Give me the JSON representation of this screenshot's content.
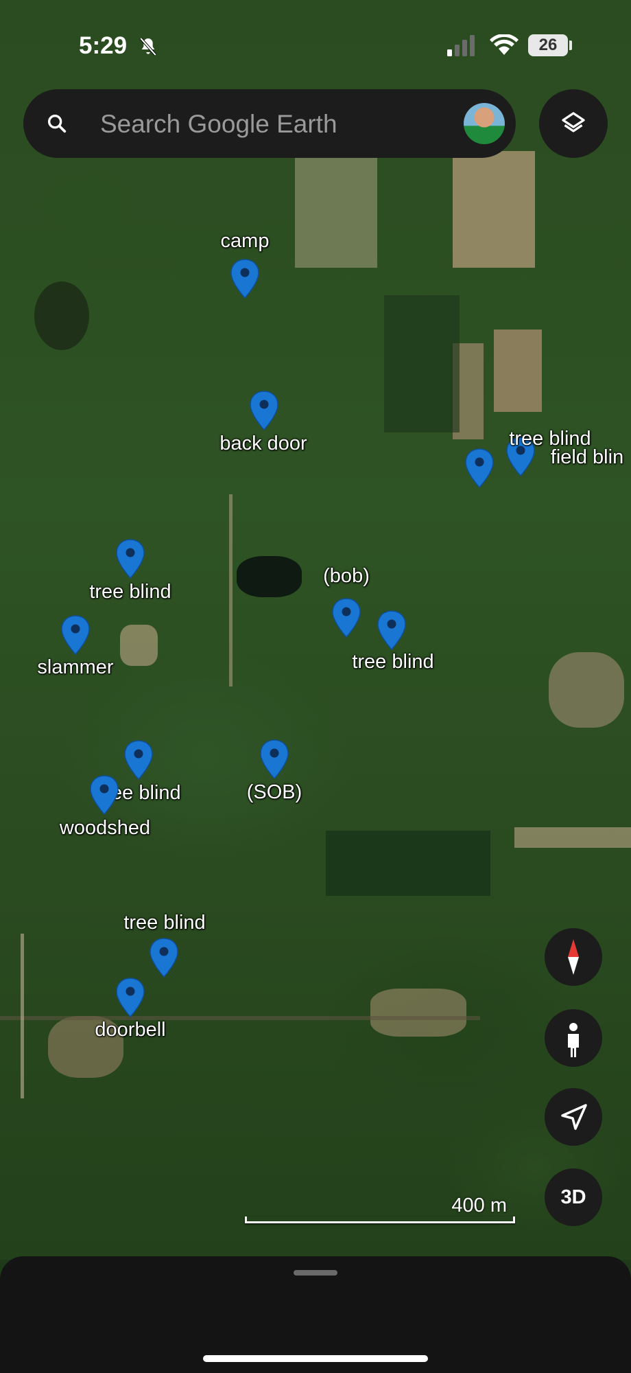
{
  "status_bar": {
    "time": "5:29",
    "battery": "26"
  },
  "search": {
    "placeholder": "Search Google Earth"
  },
  "icons": {
    "search": "search-icon",
    "layers": "layers-icon",
    "compass": "compass-icon",
    "pegman": "pegman-icon",
    "location": "location-arrow-icon",
    "mute": "bell-off-icon"
  },
  "colors": {
    "pin": "#1976d2",
    "pin_dot": "#0d2f5a",
    "label": "#ffffff",
    "panel": "#1c1c1c",
    "compass_red": "#e53935"
  },
  "placemarks": [
    {
      "label": "camp"
    },
    {
      "label": "back door"
    },
    {
      "label": "tree blind"
    },
    {
      "label": "field blin"
    },
    {
      "label": ""
    },
    {
      "label": "tree blind"
    },
    {
      "label": "slammer"
    },
    {
      "label": "(bob)"
    },
    {
      "label": "tree blind"
    },
    {
      "label": "tree blind"
    },
    {
      "label": "woodshed"
    },
    {
      "label": "(SOB)"
    },
    {
      "label": "tree blind"
    },
    {
      "label": "doorbell"
    }
  ],
  "controls": {
    "three_d": "3D"
  },
  "scale": {
    "label": "400 m"
  }
}
